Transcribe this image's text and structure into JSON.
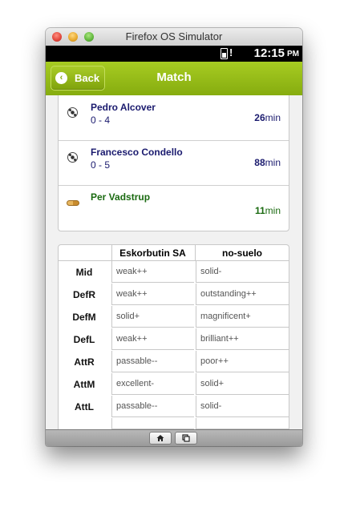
{
  "window": {
    "title": "Firefox OS Simulator"
  },
  "statusbar": {
    "battery_alert": "!",
    "time": "12:15",
    "ampm": "PM"
  },
  "header": {
    "back_label": "Back",
    "title": "Match"
  },
  "events": [
    {
      "player": "Pedro Alcover",
      "score": "0 - 4",
      "minute": "26",
      "unit": "min",
      "icon": "soccer-ball-icon"
    },
    {
      "player": "Francesco Condello",
      "score": "0 - 5",
      "minute": "88",
      "unit": "min",
      "icon": "soccer-ball-icon"
    },
    {
      "player": "Per Vadstrup",
      "score": "",
      "minute": "11",
      "unit": "min",
      "icon": "substitution-icon"
    }
  ],
  "stats": {
    "home_team": "Eskorbutin SA",
    "away_team": "no-suelo",
    "rows": [
      {
        "label": "Mid",
        "home": "weak++",
        "away": "solid-"
      },
      {
        "label": "DefR",
        "home": "weak++",
        "away": "outstanding++"
      },
      {
        "label": "DefM",
        "home": "solid+",
        "away": "magnificent+"
      },
      {
        "label": "DefL",
        "home": "weak++",
        "away": "brilliant++"
      },
      {
        "label": "AttR",
        "home": "passable--",
        "away": "poor++"
      },
      {
        "label": "AttM",
        "home": "excellent-",
        "away": "solid+"
      },
      {
        "label": "AttL",
        "home": "passable--",
        "away": "solid-"
      }
    ]
  },
  "toolbar": {
    "home_icon": "home-icon",
    "windows_icon": "windows-icon"
  },
  "colors": {
    "header_green": "#98bd19",
    "event_blue": "#1a1a6e",
    "event_green": "#1a6a10"
  }
}
